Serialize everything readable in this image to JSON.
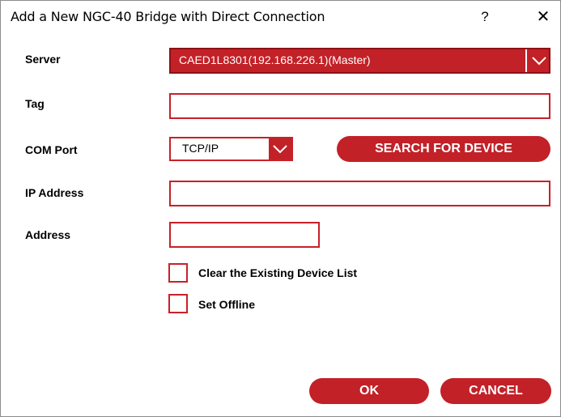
{
  "window": {
    "title": "Add a New NGC-40 Bridge with Direct Connection",
    "help_glyph": "?",
    "close_glyph": "✕"
  },
  "form": {
    "server": {
      "label": "Server",
      "value": "CAED1L8301(192.168.226.1)(Master)"
    },
    "tag": {
      "label": "Tag",
      "value": ""
    },
    "com_port": {
      "label": "COM Port",
      "value": "TCP/IP"
    },
    "ip_address": {
      "label": "IP Address",
      "value": ""
    },
    "address": {
      "label": "Address",
      "value": ""
    },
    "search_button": "SEARCH FOR DEVICE",
    "clear_list": {
      "label": "Clear the Existing Device List",
      "checked": false
    },
    "set_offline": {
      "label": "Set Offline",
      "checked": false
    }
  },
  "buttons": {
    "ok": "OK",
    "cancel": "CANCEL"
  },
  "colors": {
    "accent": "#c22127",
    "border": "#c8202a"
  }
}
